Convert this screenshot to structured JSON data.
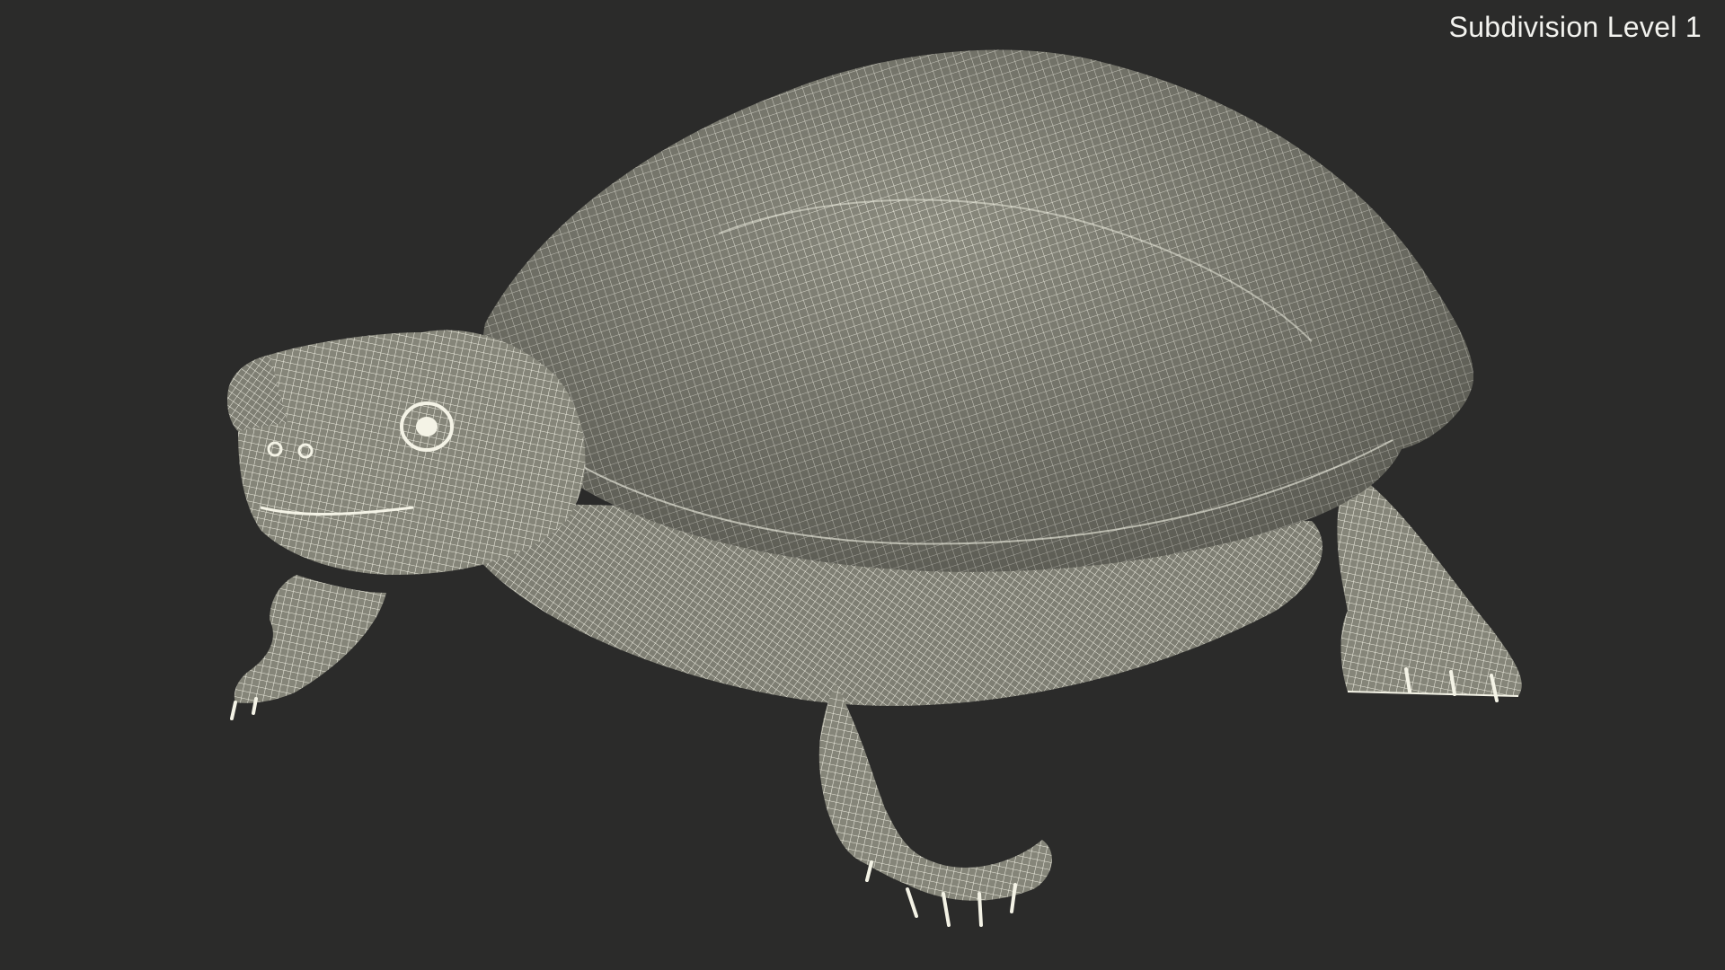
{
  "viewport": {
    "label": "Subdivision Level 1",
    "background_color": "#2b2b2a",
    "mesh_fill_color": "#8a8a7e",
    "wire_color": "#f4f3e6"
  },
  "model": {
    "icon": "turtle-wireframe-icon"
  }
}
